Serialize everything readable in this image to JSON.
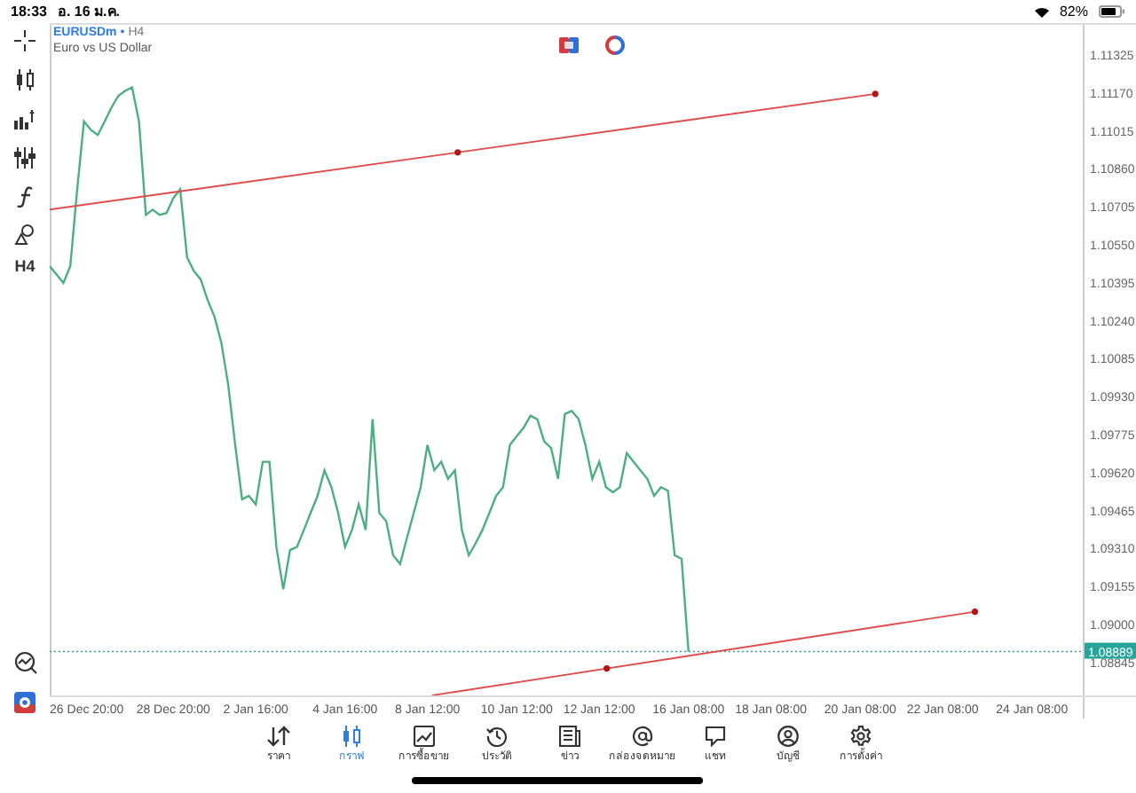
{
  "status_bar": {
    "time": "18:33",
    "date": "อ. 16 ม.ค.",
    "battery": "82%"
  },
  "toolbar": {
    "timeframe": "H4"
  },
  "chart": {
    "symbol": "EURUSDm",
    "separator": "•",
    "timeframe": "H4",
    "description": "Euro vs US Dollar",
    "current_price": "1.08889",
    "chart_data": {
      "type": "line",
      "categories": [
        null,
        null,
        null,
        null,
        null,
        "26 Dec 20:00",
        null,
        null,
        null,
        null,
        null,
        null,
        null,
        null,
        null,
        null,
        null,
        null,
        "28 Dec 20:00",
        null,
        null,
        null,
        null,
        null,
        null,
        null,
        null,
        null,
        null,
        null,
        "2 Jan 16:00",
        null,
        null,
        null,
        null,
        null,
        null,
        null,
        null,
        null,
        null,
        null,
        null,
        "4 Jan 16:00",
        null,
        null,
        null,
        null,
        null,
        null,
        null,
        null,
        null,
        null,
        null,
        "8 Jan 12:00",
        null,
        null,
        null,
        null,
        null,
        null,
        null,
        null,
        null,
        null,
        null,
        null,
        "10 Jan 12:00",
        null,
        null,
        null,
        null,
        null,
        null,
        null,
        null,
        null,
        null,
        null,
        "12 Jan 12:00",
        null,
        null,
        null,
        null,
        null,
        null,
        null,
        null,
        null,
        null,
        null,
        null,
        "16 Jan 08:00",
        null,
        null,
        null,
        null,
        null,
        null,
        null,
        null,
        null,
        null,
        null,
        "18 Jan 08:00",
        null,
        null,
        null,
        null,
        null,
        null,
        null,
        null,
        null,
        null,
        null,
        null,
        "20 Jan 08:00",
        null,
        null,
        null,
        null,
        null,
        null,
        null,
        null,
        null,
        null,
        null,
        "22 Jan 08:00",
        null,
        null,
        null,
        null,
        null,
        null,
        null,
        null,
        null,
        null,
        null,
        null,
        "24 Jan 08:00",
        null,
        null,
        null,
        null,
        null,
        null,
        null
      ],
      "series": [
        {
          "color": "#4caf82",
          "values": [
            1.10463,
            1.10428,
            1.10394,
            1.10463,
            1.10776,
            1.11054,
            1.11019,
            1.10998,
            1.11054,
            1.1111,
            1.11158,
            1.11179,
            1.11193,
            1.11054,
            1.10672,
            1.10693,
            1.10672,
            1.10679,
            1.10741,
            1.10776,
            1.10498,
            1.10442,
            1.10408,
            1.10324,
            1.10255,
            1.1015,
            1.09977,
            1.09733,
            1.09511,
            1.09525,
            1.0949,
            1.09664,
            1.09664,
            1.09316,
            1.09143,
            1.09303,
            1.09316,
            1.09386,
            1.09455,
            1.09525,
            1.09629,
            1.0956,
            1.09455,
            1.09316,
            1.09386,
            1.0949,
            1.09386,
            1.09838,
            1.09455,
            1.09421,
            1.09282,
            1.09247,
            1.09351,
            1.09455,
            1.0956,
            1.09733,
            1.09629,
            1.09664,
            1.09594,
            1.09629,
            1.09386,
            1.09282,
            1.0933,
            1.09386,
            1.09455,
            1.09525,
            1.0956,
            1.09733,
            1.09768,
            1.09803,
            1.09852,
            1.09838,
            1.09747,
            1.0972,
            1.09594,
            1.09859,
            1.09872,
            1.09838,
            1.09733,
            1.09594,
            1.09664,
            1.0956,
            1.09539,
            1.0956,
            1.09699,
            1.09664,
            1.09629,
            1.09594,
            1.09525,
            1.0956,
            1.09546,
            1.09282,
            1.09268,
            1.08889,
            null,
            null,
            null,
            null,
            null,
            null,
            null,
            null,
            null,
            null,
            null,
            null,
            null,
            null,
            null,
            null,
            null,
            null,
            null,
            null,
            null,
            null,
            null,
            null,
            null,
            null,
            null,
            null,
            null,
            null,
            null,
            null,
            null,
            null,
            null,
            null,
            null,
            null,
            null,
            null,
            null,
            null,
            null,
            null,
            null,
            null,
            null,
            null,
            null,
            null,
            null,
            null,
            null,
            null,
            null,
            null,
            null
          ]
        }
      ],
      "ylim": [
        1.0871,
        1.11455
      ],
      "ref_lines": [
        {
          "axis": "y",
          "value": 1.08889,
          "color": "#26a69a"
        }
      ],
      "yticks": [
        {
          "value": 1.11325,
          "label": "1.11325"
        },
        {
          "value": 1.1117,
          "label": "1.11170"
        },
        {
          "value": 1.11015,
          "label": "1.11015"
        },
        {
          "value": 1.1086,
          "label": "1.10860"
        },
        {
          "value": 1.10705,
          "label": "1.10705"
        },
        {
          "value": 1.1055,
          "label": "1.10550"
        },
        {
          "value": 1.10395,
          "label": "1.10395"
        },
        {
          "value": 1.1024,
          "label": "1.10240"
        },
        {
          "value": 1.10085,
          "label": "1.10085"
        },
        {
          "value": 1.0993,
          "label": "1.09930"
        },
        {
          "value": 1.09775,
          "label": "1.09775"
        },
        {
          "value": 1.0962,
          "label": "1.09620"
        },
        {
          "value": 1.09465,
          "label": "1.09465"
        },
        {
          "value": 1.0931,
          "label": "1.09310"
        },
        {
          "value": 1.09155,
          "label": "1.09155"
        },
        {
          "value": 1.09,
          "label": "1.09000"
        },
        {
          "value": 1.08845,
          "label": "1.08845"
        }
      ]
    }
  },
  "tabs": [
    {
      "label": "ราคา",
      "selected": false
    },
    {
      "label": "กราฟ",
      "selected": true
    },
    {
      "label": "การซื้อขาย",
      "selected": false
    },
    {
      "label": "ประวัติ",
      "selected": false
    },
    {
      "label": "ข่าว",
      "selected": false
    },
    {
      "label": "กล่องจดหมาย",
      "selected": false
    },
    {
      "label": "แชท",
      "selected": false
    },
    {
      "label": "บัญชี",
      "selected": false
    },
    {
      "label": "การตั้งค่า",
      "selected": false
    }
  ]
}
